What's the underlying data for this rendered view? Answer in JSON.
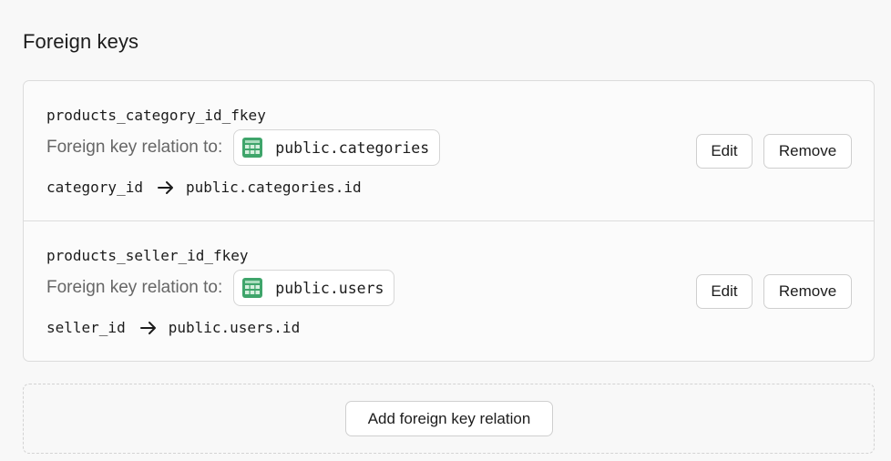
{
  "section": {
    "title": "Foreign keys"
  },
  "foreign_keys": [
    {
      "name": "products_category_id_fkey",
      "relation_label": "Foreign key relation to:",
      "table_icon": "table-grid-icon",
      "target_table": "public.categories",
      "source_column": "category_id",
      "arrow_icon": "arrow-right-icon",
      "target_column": "public.categories.id",
      "edit_label": "Edit",
      "remove_label": "Remove"
    },
    {
      "name": "products_seller_id_fkey",
      "relation_label": "Foreign key relation to:",
      "table_icon": "table-grid-icon",
      "target_table": "public.users",
      "source_column": "seller_id",
      "arrow_icon": "arrow-right-icon",
      "target_column": "public.users.id",
      "edit_label": "Edit",
      "remove_label": "Remove"
    }
  ],
  "add_button": {
    "label": "Add foreign key relation"
  },
  "colors": {
    "table_icon_green": "#3fa56b",
    "muted_text": "#666666",
    "border": "#dcdcdc"
  }
}
